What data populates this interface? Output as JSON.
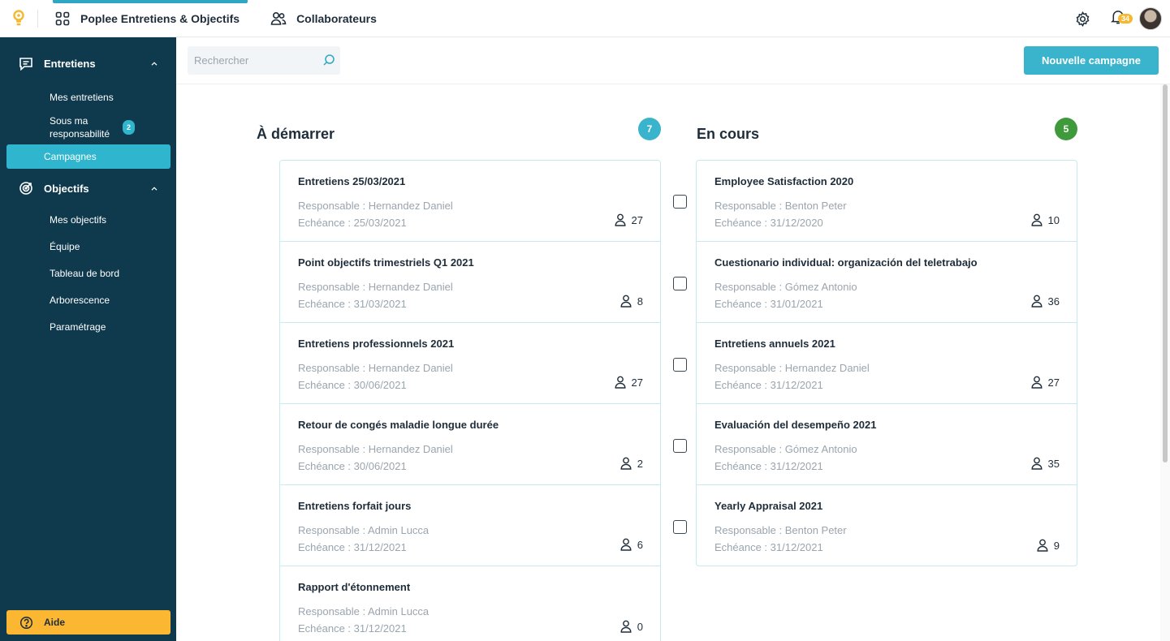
{
  "topbar": {
    "logo": "lightbulb-logo-icon",
    "tabs": [
      {
        "label": "Poplee Entretiens & Objectifs",
        "icon": "grid-icon",
        "active": true
      },
      {
        "label": "Collaborateurs",
        "icon": "users-icon",
        "active": false
      }
    ],
    "notifications_count": "34",
    "settings_icon": "gear-icon",
    "bell_icon": "bell-icon"
  },
  "sidebar": {
    "sections": [
      {
        "label": "Entretiens",
        "icon": "chat-icon",
        "items": [
          {
            "label": "Mes entretiens"
          },
          {
            "label": "Sous ma responsabilité",
            "badge": "2"
          },
          {
            "label": "Campagnes",
            "active": true
          }
        ]
      },
      {
        "label": "Objectifs",
        "icon": "target-icon",
        "items": [
          {
            "label": "Mes objectifs"
          },
          {
            "label": "Équipe"
          },
          {
            "label": "Tableau de bord"
          },
          {
            "label": "Arborescence"
          },
          {
            "label": "Paramétrage"
          }
        ]
      }
    ],
    "help_label": "Aide"
  },
  "header": {
    "search_placeholder": "Rechercher",
    "new_campaign_label": "Nouvelle campagne"
  },
  "columns": [
    {
      "title": "À démarrer",
      "count": "7",
      "badge_color": "#3ab4cd",
      "cards": [
        {
          "title": "Entretiens 25/03/2021",
          "manager": "Responsable : Hernandez Daniel",
          "due": "Echéance : 25/03/2021",
          "participants": "27"
        },
        {
          "title": "Point objectifs trimestriels Q1 2021",
          "manager": "Responsable : Hernandez Daniel",
          "due": "Echéance : 31/03/2021",
          "participants": "8"
        },
        {
          "title": "Entretiens professionnels 2021",
          "manager": "Responsable : Hernandez Daniel",
          "due": "Echéance : 30/06/2021",
          "participants": "27"
        },
        {
          "title": "Retour de congés maladie longue durée",
          "manager": "Responsable : Hernandez Daniel",
          "due": "Echéance : 30/06/2021",
          "participants": "2"
        },
        {
          "title": "Entretiens forfait jours",
          "manager": "Responsable : Admin Lucca",
          "due": "Echéance : 31/12/2021",
          "participants": "6"
        },
        {
          "title": "Rapport d'étonnement",
          "manager": "Responsable : Admin Lucca",
          "due": "Echéance : 31/12/2021",
          "participants": "0"
        }
      ]
    },
    {
      "title": "En cours",
      "count": "5",
      "badge_color": "#3e9a3a",
      "cards": [
        {
          "title": "Employee Satisfaction 2020",
          "manager": "Responsable : Benton Peter",
          "due": "Echéance : 31/12/2020",
          "participants": "10"
        },
        {
          "title": "Cuestionario individual: organización del teletrabajo",
          "manager": "Responsable : Gómez Antonio",
          "due": "Echéance : 31/01/2021",
          "participants": "36"
        },
        {
          "title": "Entretiens annuels 2021",
          "manager": "Responsable : Hernandez Daniel",
          "due": "Echéance : 31/12/2021",
          "participants": "27"
        },
        {
          "title": "Evaluación del desempeño 2021",
          "manager": "Responsable : Gómez Antonio",
          "due": "Echéance : 31/12/2021",
          "participants": "35"
        },
        {
          "title": "Yearly Appraisal 2021",
          "manager": "Responsable : Benton Peter",
          "due": "Echéance : 31/12/2021",
          "participants": "9"
        }
      ]
    }
  ],
  "colors": {
    "sidebar_bg": "#0f3a4e",
    "accent": "#3ab4cd",
    "help_yellow": "#fbb731",
    "in_progress_green": "#3e9a3a"
  }
}
